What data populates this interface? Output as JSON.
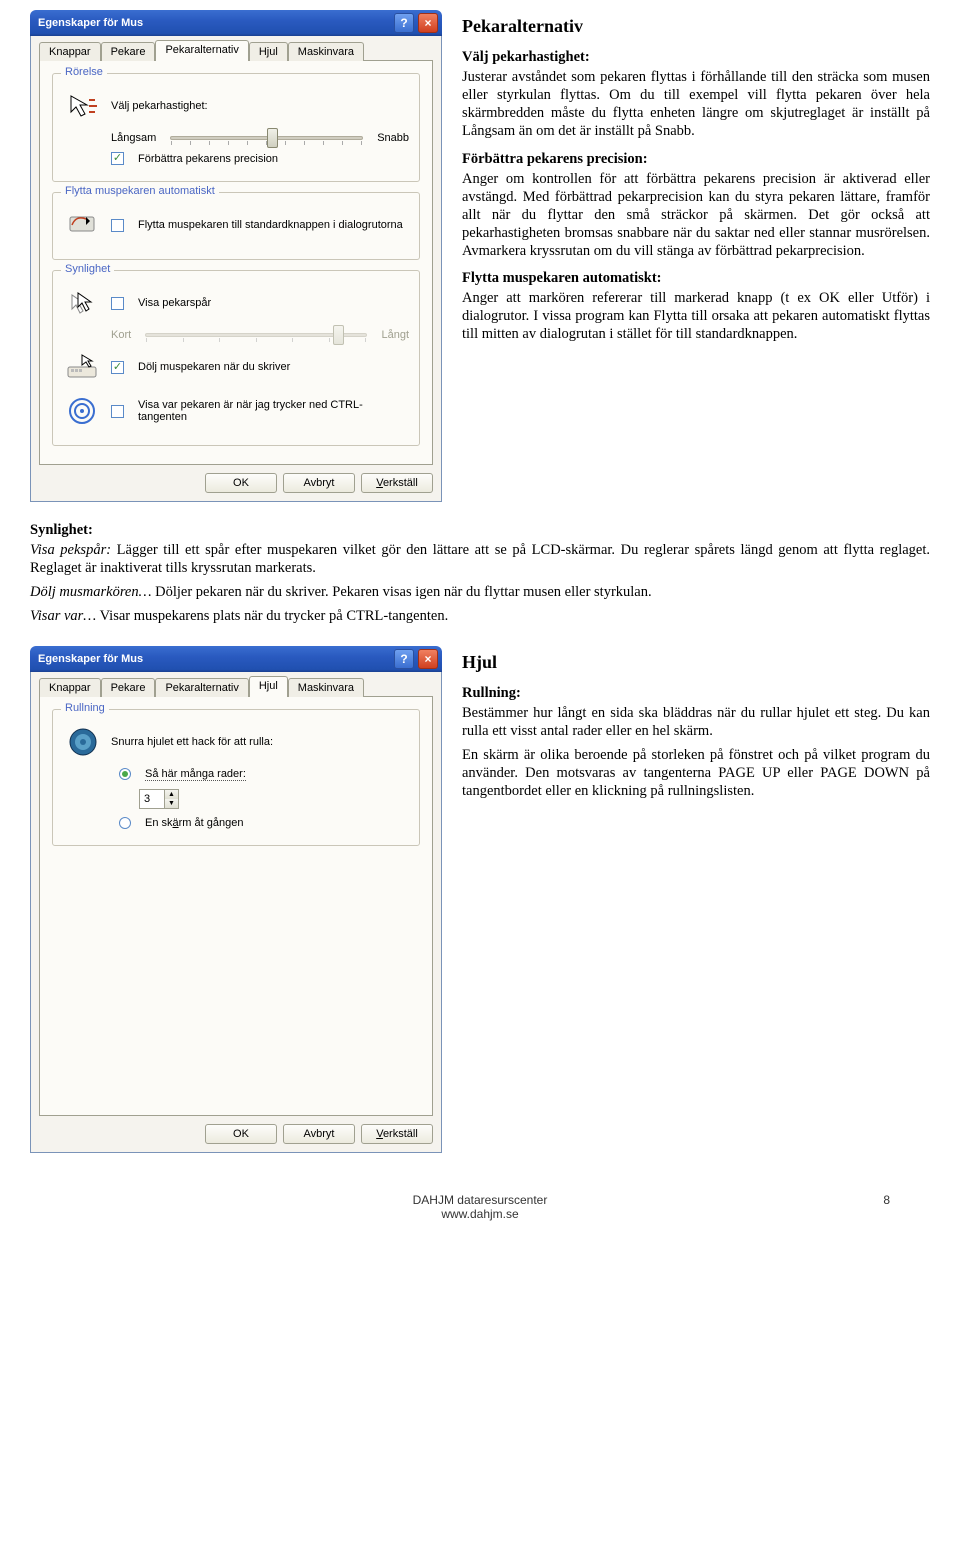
{
  "dialog1": {
    "title": "Egenskaper för Mus",
    "tabs": [
      "Knappar",
      "Pekare",
      "Pekaralternativ",
      "Hjul",
      "Maskinvara"
    ],
    "active_tab": "Pekaralternativ",
    "group_rorelse": "Rörelse",
    "speed_label": "Välj pekarhastighet:",
    "slow": "Långsam",
    "fast": "Snabb",
    "precision": "Förbättra pekarens precision",
    "group_flytta": "Flytta muspekaren automatiskt",
    "flytta_label": "Flytta muspekaren till standardknappen i dialogrutorna",
    "group_synlighet": "Synlighet",
    "visa_pekspar": "Visa pekarspår",
    "kort": "Kort",
    "langt": "Långt",
    "dolj": "Dölj muspekaren när du skriver",
    "visa_ctrl": "Visa var pekaren är när jag trycker ned CTRL-tangenten",
    "ok": "OK",
    "cancel": "Avbryt",
    "apply": "Verkställ"
  },
  "dialog2": {
    "title": "Egenskaper för Mus",
    "tabs": [
      "Knappar",
      "Pekare",
      "Pekaralternativ",
      "Hjul",
      "Maskinvara"
    ],
    "active_tab": "Hjul",
    "group_rullning": "Rullning",
    "snurra": "Snurra hjulet ett hack för att rulla:",
    "rader_label": "Så här många rader:",
    "rader_value": "3",
    "skarm_label": "En skärm åt gången",
    "ok": "OK",
    "cancel": "Avbryt",
    "apply": "Verkställ"
  },
  "doc": {
    "h1": "Pekaralternativ",
    "s1_head": "Välj pekarhastighet:",
    "s1": "Justerar avståndet som pekaren flyttas i förhållande till den sträcka som musen eller styrkulan flyttas. Om du till exempel vill flytta pekaren över hela skärmbredden måste du flytta enheten längre om skjutreglaget är inställt på Långsam än om det är inställt på Snabb.",
    "s2_head": "Förbättra pekarens precision:",
    "s2": "Anger om kontrollen för att förbättra pekarens precision är aktiverad eller avstängd. Med förbättrad pekarprecision kan du styra pekaren lättare, framför allt när du flyttar den små sträckor på skärmen. Det gör också att pekarhastigheten bromsas snabbare när du saktar ned eller stannar musrörelsen. Avmarkera kryssrutan om du vill stänga av förbättrad pekarprecision.",
    "s3_head": "Flytta muspekaren automatiskt:",
    "s3": "Anger att markören refererar till markerad knapp (t ex OK eller Utför) i dialogrutor. I vissa program kan Flytta till orsaka att pekaren automatiskt flyttas till mitten av dialogrutan i stället för till standardknappen.",
    "s4_head": "Synlighet:",
    "s4_line1_em": "Visa pekspår:",
    "s4_line1": " Lägger till ett spår efter muspekaren vilket gör den lättare att se på LCD-skärmar. Du reglerar spårets längd genom att flytta reglaget. Reglaget är inaktiverat tills kryssrutan markerats.",
    "s4_line2_em": "Dölj musmarkören…",
    "s4_line2": " Döljer pekaren när du skriver. Pekaren visas igen när du flyttar musen eller styrkulan.",
    "s4_line3_em": "Visar var…",
    "s4_line3": " Visar muspekarens plats när du trycker på CTRL-tangenten.",
    "h2": "Hjul",
    "s5_head": "Rullning:",
    "s5": "Bestämmer hur långt en sida ska bläddras när du rullar hjulet ett steg. Du kan rulla ett visst antal rader eller en hel skärm.",
    "s6": "En skärm är olika beroende på storleken på fönstret och på vilket program du använder. Den motsvaras av tangenterna PAGE UP eller PAGE DOWN på tangentbordet eller en klickning på rullningslisten."
  },
  "footer": {
    "org": "DAHJM dataresurscenter",
    "url": "www.dahjm.se",
    "page": "8"
  }
}
